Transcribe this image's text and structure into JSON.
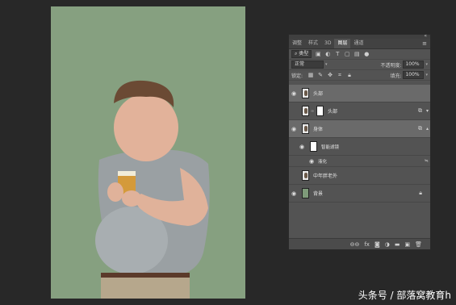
{
  "colors": {
    "app_bg": "#282828",
    "canvas_bg": "#86a080",
    "panel_bg": "#535353",
    "highlight": "#6a6a6a"
  },
  "panel": {
    "tabs": [
      "调整",
      "样式",
      "3D",
      "图层",
      "通道"
    ],
    "active_tab": "图层",
    "filter_kind": "类型",
    "blend_mode": "正常",
    "opacity_label": "不透明度:",
    "opacity_value": "100%",
    "lock_label": "锁定:",
    "fill_label": "填充:",
    "fill_value": "100%"
  },
  "layers": [
    {
      "name": "头部",
      "visible": true
    },
    {
      "name": "头部",
      "visible": false
    },
    {
      "name": "身体",
      "visible": true
    },
    {
      "name": "智能滤镜",
      "visible": true
    },
    {
      "name": "液化",
      "visible": true
    },
    {
      "name": "中年胖老外",
      "visible": false
    },
    {
      "name": "背景",
      "visible": true
    }
  ],
  "icons": {
    "eye": "eye-icon",
    "lock": "lock-icon",
    "link": "link-icon",
    "fx": "fx-icon",
    "trash": "trash-icon",
    "new_layer": "new-layer-icon",
    "folder": "folder-icon"
  },
  "watermark": "头条号 / 部落窝教育h"
}
